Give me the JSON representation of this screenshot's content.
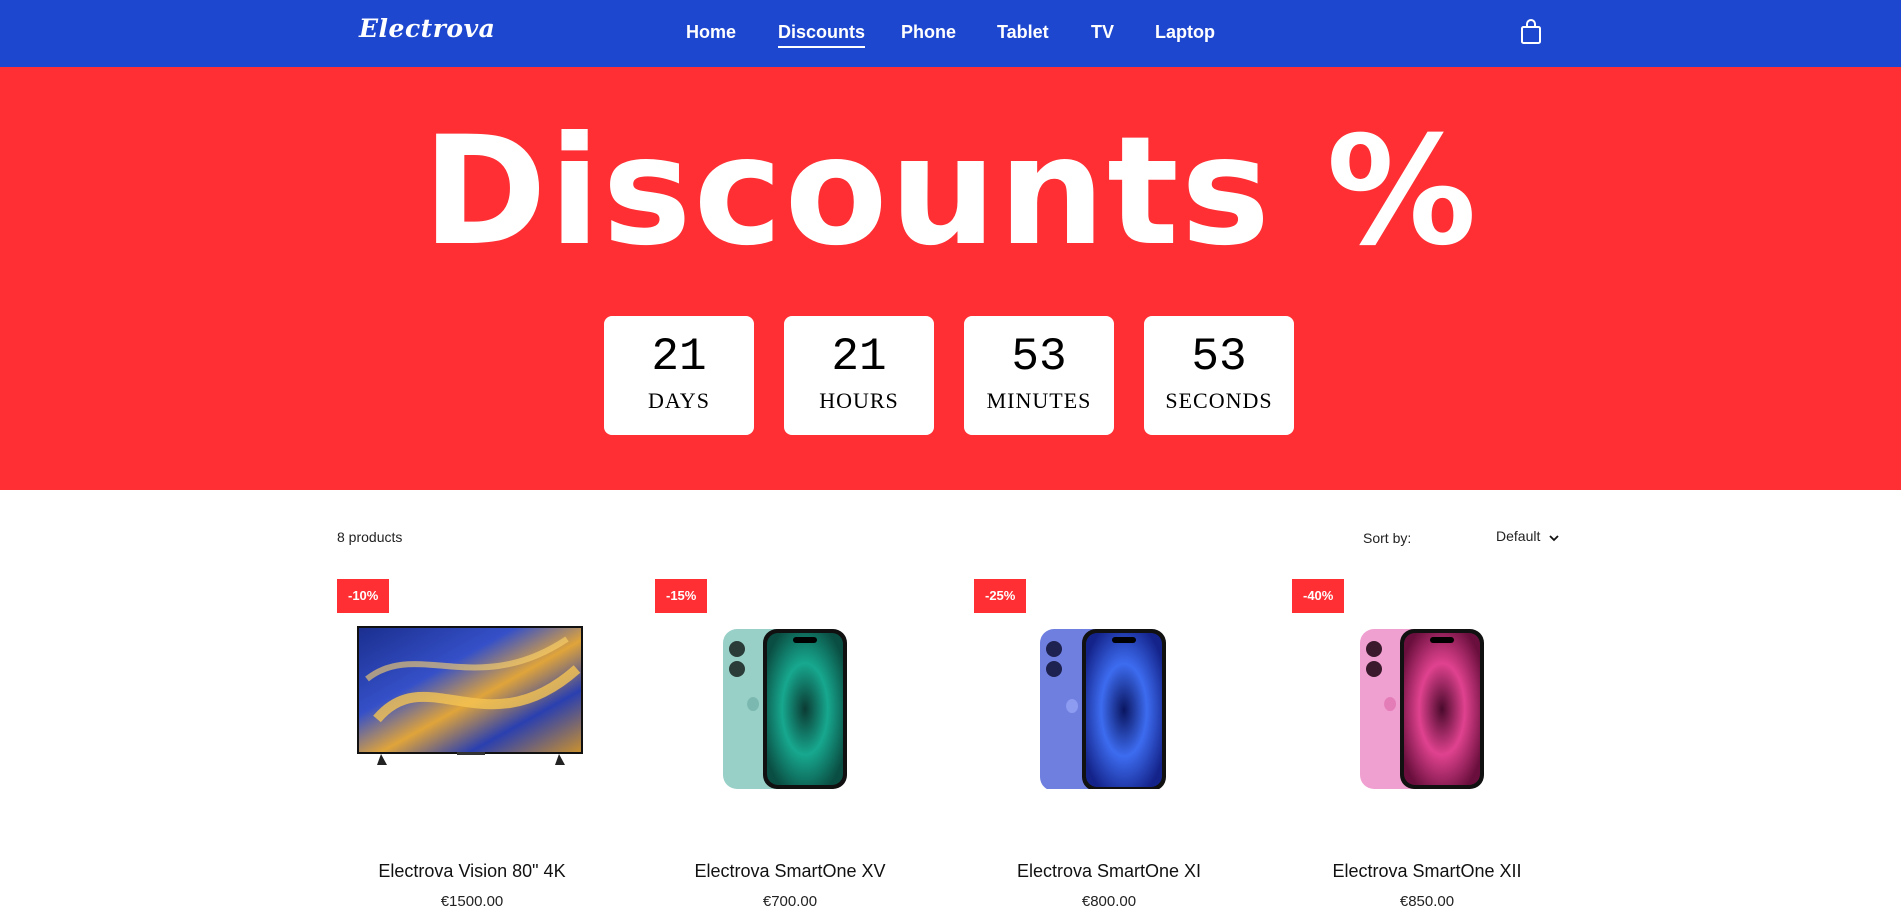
{
  "header": {
    "logo": "Electrova",
    "nav": [
      "Home",
      "Discounts",
      "Phone",
      "Tablet",
      "TV",
      "Laptop"
    ],
    "active_nav": "Discounts",
    "cart_icon": "shopping-bag-icon"
  },
  "hero": {
    "title": "Discounts %",
    "countdown": [
      {
        "value": "21",
        "label": "DAYS"
      },
      {
        "value": "21",
        "label": "HOURS"
      },
      {
        "value": "53",
        "label": "MINUTES"
      },
      {
        "value": "53",
        "label": "SECONDS"
      }
    ]
  },
  "listing": {
    "count_text": "8 products",
    "sort_label": "Sort by:",
    "sort_value": "Default"
  },
  "products": [
    {
      "badge": "-10%",
      "name": "Electrova Vision 80\" 4K",
      "price": "€1500.00",
      "image": "tv-image"
    },
    {
      "badge": "-15%",
      "name": "Electrova SmartOne XV",
      "price": "€700.00",
      "image": "phone-image-teal"
    },
    {
      "badge": "-25%",
      "name": "Electrova SmartOne XI",
      "price": "€800.00",
      "image": "phone-image-blue"
    },
    {
      "badge": "-40%",
      "name": "Electrova SmartOne XII",
      "price": "€850.00",
      "image": "phone-image-pink"
    }
  ],
  "colors": {
    "header_bg": "#1e47cf",
    "hero_bg": "#ff2f33",
    "badge_bg": "#ff2f33"
  }
}
